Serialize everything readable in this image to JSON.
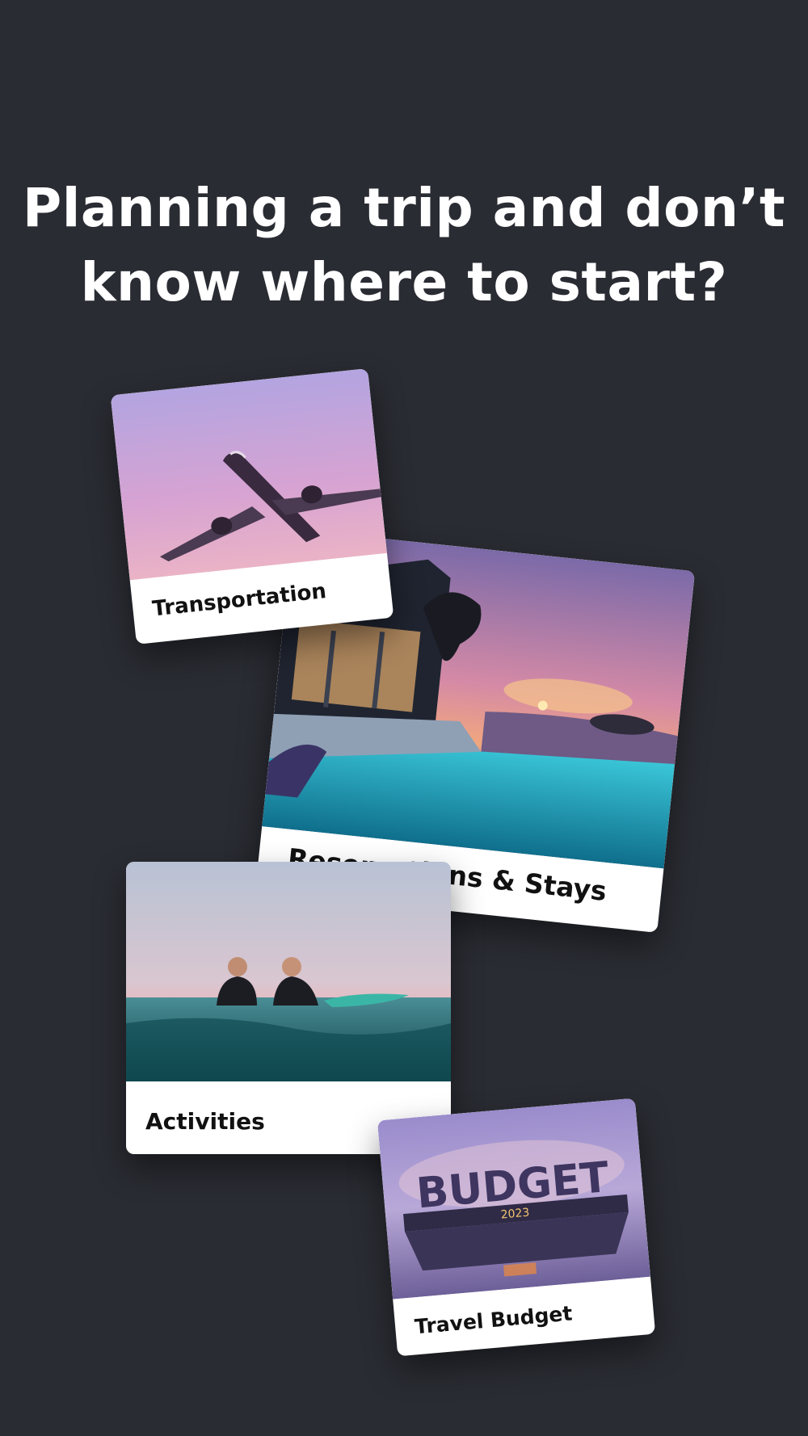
{
  "headline": {
    "line1": "Planning a trip and don’t",
    "line2": "know where to start?"
  },
  "cards": {
    "transportation": {
      "label": "Transportation"
    },
    "reservations": {
      "label": "Reservations & Stays"
    },
    "activities": {
      "label": "Activities"
    },
    "budget": {
      "label": "Travel Budget",
      "sign_title": "BUDGET",
      "sign_year": "2023"
    }
  },
  "colors": {
    "background": "#2a2c33",
    "card": "#ffffff",
    "headline": "#ffffff"
  }
}
